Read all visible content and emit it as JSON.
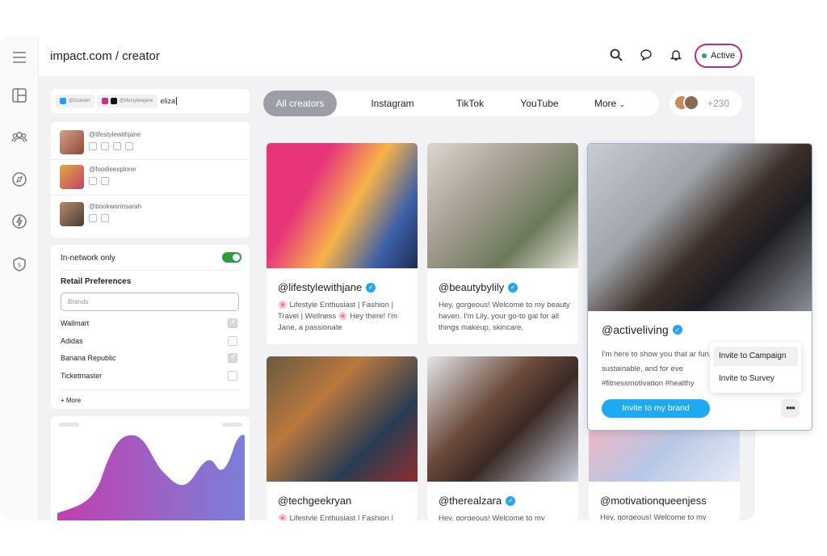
{
  "brand": "impact.com / creator",
  "status_button": "Active",
  "search": {
    "chips": [
      "@lizatoler",
      "@lifestylewjane"
    ],
    "query": "eliza"
  },
  "creator_list": [
    {
      "handle": "@lifestylewithjane",
      "socials": [
        "instagram-icon",
        "tiktok-icon",
        "twitter-icon",
        "youtube-icon"
      ]
    },
    {
      "handle": "@foodieexplorer",
      "socials": [
        "instagram-icon",
        "tiktok-icon"
      ]
    },
    {
      "handle": "@bookwormsarah",
      "socials": [
        "twitter-icon",
        "youtube-icon"
      ]
    }
  ],
  "filters": {
    "in_network_label": "In-network only",
    "in_network_on": true,
    "retail_title": "Retail Preferences",
    "brands_placeholder": "Brands",
    "brands": [
      {
        "name": "Wallmart",
        "checked": true
      },
      {
        "name": "Adidas",
        "checked": false
      },
      {
        "name": "Banana Republic",
        "checked": true
      },
      {
        "name": "Ticketmaster",
        "checked": false
      }
    ],
    "more_label": "+ More"
  },
  "tabs": [
    "All creators",
    "Instagram",
    "TikTok",
    "YouTube",
    "More"
  ],
  "creator_count": "+230",
  "cards": [
    {
      "handle": "@lifestylewithjane",
      "verified": true,
      "bio": "🌸 Lifestyle Enthusiast | Fashion | Travel | Wellness 🌸 Hey there! I'm Jane, a passionate"
    },
    {
      "handle": "@beautybylily",
      "verified": true,
      "bio": "Hey, gorgeous! Welcome to my beauty haven. I'm Lily, your go-to gal for all things makeup, skincare,"
    },
    {
      "handle": "@techgeekryan",
      "verified": false,
      "bio": "🌸 Lifestyle Enthusiast | Fashion |"
    },
    {
      "handle": "@therealzara",
      "verified": true,
      "bio": "Hey, gorgeous! Welcome to my"
    },
    {
      "handle": "@motivationqueenjess",
      "verified": false,
      "bio": "Hey, gorgeous! Welcome to my"
    }
  ],
  "featured": {
    "handle": "@activeliving",
    "verified": true,
    "bio": "I'm here to show you that ar fun, sustainable, and for eve #fitnessmotivation #healthy",
    "invite_label": "Invite to my brand",
    "more_label": "•••"
  },
  "menu": [
    "Invite to Campaign",
    "Invite to Survey"
  ],
  "colors": {
    "accent": "#1eaaf1",
    "active_border": "#b52a8c",
    "toggle": "#2e9b3e",
    "verified": "#2aa3ef"
  }
}
